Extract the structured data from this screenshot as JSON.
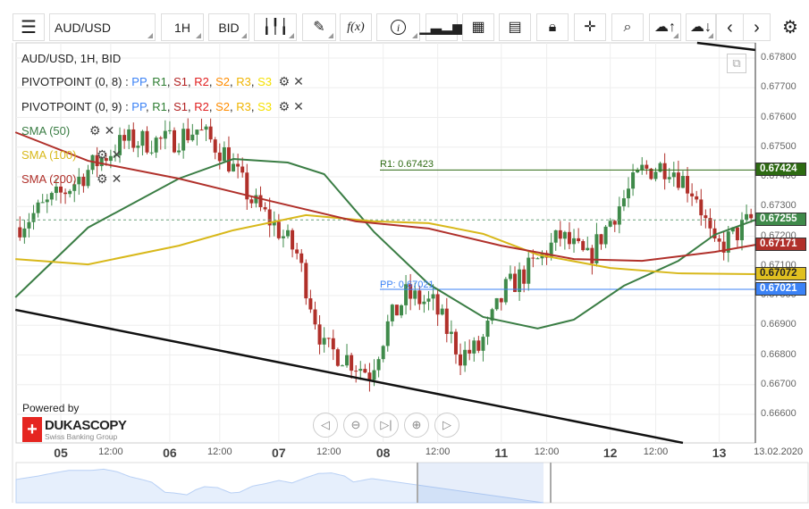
{
  "toolbar": {
    "menu_icon": "hamburger-icon",
    "symbol": "AUD/USD",
    "period": "1H",
    "side": "BID",
    "fx_label": "f(x)",
    "icons": [
      "candlestick-icon",
      "pencil-icon",
      "function-icon",
      "info-icon",
      "bar-chart-icon",
      "calendar-icon",
      "news-icon",
      "lock-icon",
      "crosshair-icon",
      "zoom-search-icon",
      "cloud-upload-icon",
      "cloud-download-icon",
      "chevron-left-icon",
      "chevron-right-icon",
      "gear-icon"
    ]
  },
  "legend": {
    "title": "AUD/USD, 1H, BID",
    "pivots": [
      {
        "label": "PIVOTPOINT (0, 8)",
        "sep": " : "
      },
      {
        "label": "PIVOTPOINT (0, 9)",
        "sep": " : "
      }
    ],
    "pivot_parts": [
      {
        "t": "PP",
        "c": "#3b82f6"
      },
      {
        "t": "R1",
        "c": "#2e7d32"
      },
      {
        "t": "S1",
        "c": "#b22222"
      },
      {
        "t": "R2",
        "c": "#e02020"
      },
      {
        "t": "S2",
        "c": "#ff8c00"
      },
      {
        "t": "R3",
        "c": "#f0b400"
      },
      {
        "t": "S3",
        "c": "#f5e000"
      }
    ],
    "smas": [
      {
        "label": "SMA (50)",
        "color": "#3a7d44"
      },
      {
        "label": "SMA (100)",
        "color": "#d8b81a"
      },
      {
        "label": "SMA (200)",
        "color": "#b0302a"
      }
    ]
  },
  "annotations": {
    "r1": "R1: 0.67423",
    "pp": "PP: 0.67021"
  },
  "price_tags": [
    {
      "value": "0.67424",
      "color": "#2d6a12"
    },
    {
      "value": "0.67255",
      "color": "#3f8a4a"
    },
    {
      "value": "0.67171",
      "color": "#b0302a"
    },
    {
      "value": "0.67072",
      "color": "#e0c020",
      "text": "#222"
    },
    {
      "value": "0.67021",
      "color": "#3b82f6"
    }
  ],
  "branding": {
    "powered": "Powered by",
    "name": "DUKASCOPY",
    "sub": "Swiss Banking Group"
  },
  "nav_buttons": [
    "scroll-left",
    "zoom-out",
    "go-to-end",
    "zoom-in",
    "scroll-right"
  ],
  "chart_data": {
    "type": "candlestick",
    "symbol": "AUD/USD",
    "timeframe": "1H",
    "side": "BID",
    "ylim": [
      0.665,
      0.6785
    ],
    "y_ticks": [
      "0.67800",
      "0.67700",
      "0.67600",
      "0.67500",
      "0.67400",
      "0.67300",
      "0.67200",
      "0.67100",
      "0.67000",
      "0.66900",
      "0.66800",
      "0.66700",
      "0.66600"
    ],
    "x_ticks": [
      {
        "label": "05",
        "h": 0,
        "day": true
      },
      {
        "label": "12:00",
        "h": 11
      },
      {
        "label": "06",
        "h": 24,
        "day": true
      },
      {
        "label": "12:00",
        "h": 35
      },
      {
        "label": "07",
        "h": 48,
        "day": true
      },
      {
        "label": "12:00",
        "h": 59
      },
      {
        "label": "08",
        "h": 71,
        "day": true
      },
      {
        "label": "12:00",
        "h": 83
      },
      {
        "label": "11",
        "h": 97,
        "day": true
      },
      {
        "label": "12:00",
        "h": 107
      },
      {
        "label": "12",
        "h": 121,
        "day": true
      },
      {
        "label": "12:00",
        "h": 131
      },
      {
        "label": "13",
        "h": 145,
        "day": true
      },
      {
        "label": "13.02.2020",
        "h": 158
      }
    ],
    "xlim": [
      -10,
      153
    ],
    "close_path": [
      [
        -10,
        0.6723
      ],
      [
        0,
        0.6734
      ],
      [
        8,
        0.6745
      ],
      [
        14,
        0.6752
      ],
      [
        24,
        0.6752
      ],
      [
        30,
        0.6756
      ],
      [
        36,
        0.6748
      ],
      [
        42,
        0.6732
      ],
      [
        48,
        0.6722
      ],
      [
        52,
        0.6714
      ],
      [
        58,
        0.6682
      ],
      [
        62,
        0.668
      ],
      [
        68,
        0.6674
      ],
      [
        72,
        0.669
      ],
      [
        76,
        0.67
      ],
      [
        82,
        0.6697
      ],
      [
        88,
        0.668
      ],
      [
        92,
        0.6682
      ],
      [
        98,
        0.6702
      ],
      [
        104,
        0.671
      ],
      [
        110,
        0.672
      ],
      [
        116,
        0.6712
      ],
      [
        122,
        0.6728
      ],
      [
        128,
        0.6742
      ],
      [
        134,
        0.6744
      ],
      [
        140,
        0.6734
      ],
      [
        144,
        0.6715
      ],
      [
        148,
        0.672
      ],
      [
        152,
        0.67255
      ]
    ],
    "sma50": [
      [
        -10,
        0.66994
      ],
      [
        6,
        0.67229
      ],
      [
        26,
        0.67394
      ],
      [
        38,
        0.6746
      ],
      [
        50,
        0.67448
      ],
      [
        58,
        0.67409
      ],
      [
        69,
        0.67214
      ],
      [
        81,
        0.67039
      ],
      [
        93,
        0.66928
      ],
      [
        105,
        0.66889
      ],
      [
        113,
        0.66919
      ],
      [
        124,
        0.67033
      ],
      [
        136,
        0.67117
      ],
      [
        144,
        0.67205
      ],
      [
        153,
        0.67255
      ]
    ],
    "sma100": [
      [
        -10,
        0.67123
      ],
      [
        6,
        0.67105
      ],
      [
        26,
        0.67168
      ],
      [
        38,
        0.6722
      ],
      [
        54,
        0.67271
      ],
      [
        69,
        0.6725
      ],
      [
        81,
        0.67244
      ],
      [
        93,
        0.67208
      ],
      [
        105,
        0.67138
      ],
      [
        121,
        0.67093
      ],
      [
        136,
        0.67075
      ],
      [
        153,
        0.67072
      ]
    ],
    "sma200": [
      [
        -10,
        0.6755
      ],
      [
        6,
        0.67454
      ],
      [
        26,
        0.67394
      ],
      [
        46,
        0.67319
      ],
      [
        65,
        0.6725
      ],
      [
        81,
        0.67226
      ],
      [
        97,
        0.67168
      ],
      [
        113,
        0.67123
      ],
      [
        128,
        0.67117
      ],
      [
        144,
        0.67147
      ],
      [
        153,
        0.67171
      ]
    ],
    "pivot_lines": [
      {
        "name": "R1",
        "value": 0.67423,
        "from_h": 70
      },
      {
        "name": "PP",
        "value": 0.67021,
        "from_h": 70
      }
    ],
    "current_price": 0.67255,
    "trendlines": [
      [
        [
          -10,
          0.66952
        ],
        [
          137,
          0.66504
        ]
      ],
      [
        [
          137,
          0.67857
        ],
        [
          153,
          0.67827
        ]
      ]
    ]
  }
}
